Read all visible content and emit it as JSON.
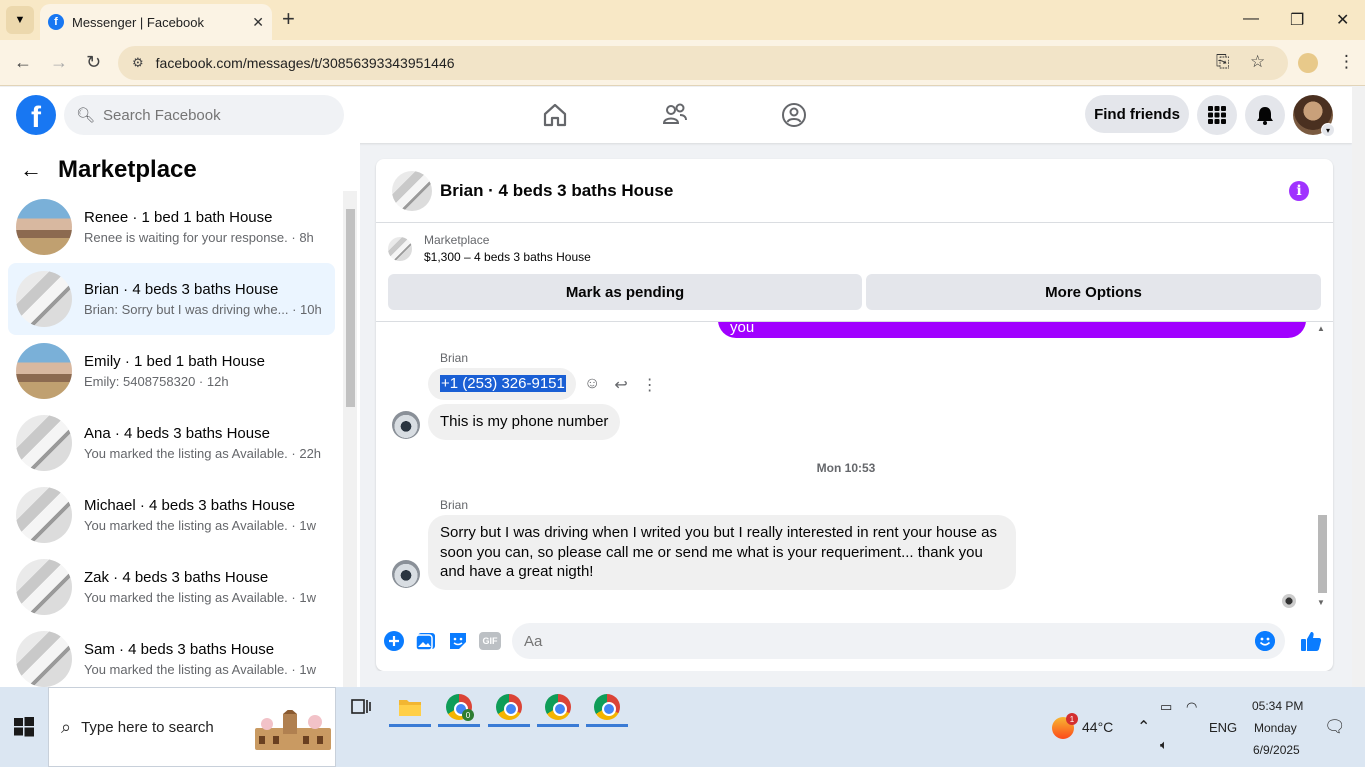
{
  "browser": {
    "tab_title": "Messenger | Facebook",
    "url": "facebook.com/messages/t/30856393343951446"
  },
  "fb": {
    "search_placeholder": "Search Facebook",
    "find_friends": "Find friends"
  },
  "sidebar": {
    "title": "Marketplace",
    "items": [
      {
        "name": "Renee · 1 bed 1 bath House",
        "sub": "Renee is waiting for your response. · 8h",
        "thumb": "house1",
        "active": false
      },
      {
        "name": "Brian · 4 beds 3 baths House",
        "sub": "Brian: Sorry but I was driving whe...  · 10h",
        "thumb": "house2",
        "active": true
      },
      {
        "name": "Emily · 1 bed 1 bath House",
        "sub": "Emily: 5408758320 · 12h",
        "thumb": "house1",
        "active": false
      },
      {
        "name": "Ana · 4 beds 3 baths House",
        "sub": "You marked the listing as Available. · 22h",
        "thumb": "house2",
        "active": false
      },
      {
        "name": "Michael · 4 beds 3 baths House",
        "sub": "You marked the listing as Available. · 1w",
        "thumb": "house2",
        "active": false
      },
      {
        "name": "Zak · 4 beds 3 baths House",
        "sub": "You marked the listing as Available. · 1w",
        "thumb": "house2",
        "active": false
      },
      {
        "name": "Sam · 4 beds 3 baths House",
        "sub": "You marked the listing as Available. · 1w",
        "thumb": "house2",
        "active": false
      }
    ]
  },
  "chat": {
    "header_name": "Brian · 4 beds 3 baths House",
    "listing_category": "Marketplace",
    "listing_price": "$1,300 – 4 beds 3 baths House",
    "mark_pending": "Mark as pending",
    "more_options": "More Options",
    "my_partial_message": "you",
    "sender_1": "Brian",
    "phone_message": "+1 (253) 326-9151",
    "message_2": "This is my phone number",
    "timestamp": "Mon 10:53",
    "sender_2": "Brian",
    "message_3": "Sorry but I was driving when I writed you but I really  interested in rent your house as soon you can, so please call me or send me what is your requeriment... thank you and have a great nigth!",
    "composer_placeholder": "Aa"
  },
  "taskbar": {
    "search_placeholder": "Type here to search",
    "weather_temp": "44°C",
    "weather_badge": "1",
    "language": "ENG",
    "time": "05:34 PM",
    "day": "Monday",
    "date": "6/9/2025",
    "chrome_badge": "0"
  },
  "colors": {
    "fb_blue": "#1877f2",
    "my_bubble": "#a100ff",
    "selection": "#1a5fd4",
    "messenger_blue": "#0a7cff"
  }
}
